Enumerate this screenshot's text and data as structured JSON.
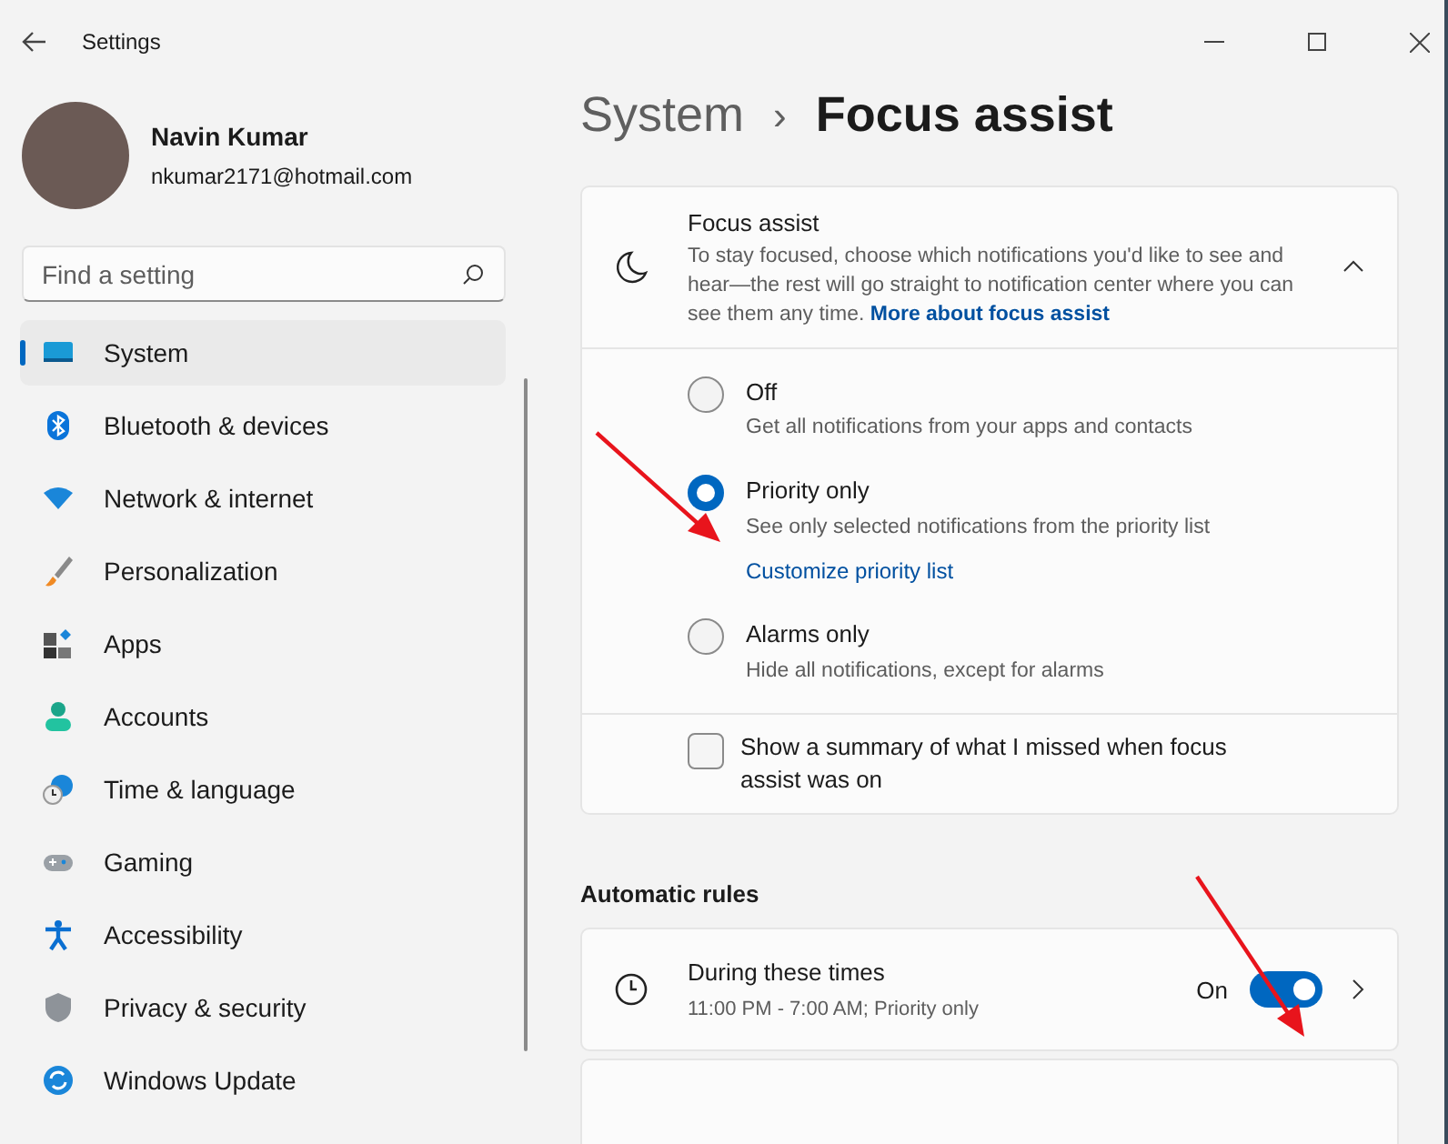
{
  "window": {
    "title": "Settings"
  },
  "account": {
    "name": "Navin Kumar",
    "email": "nkumar2171@hotmail.com"
  },
  "search": {
    "placeholder": "Find a setting"
  },
  "sidebar": {
    "items": [
      {
        "label": "System",
        "selected": true
      },
      {
        "label": "Bluetooth & devices",
        "selected": false
      },
      {
        "label": "Network & internet",
        "selected": false
      },
      {
        "label": "Personalization",
        "selected": false
      },
      {
        "label": "Apps",
        "selected": false
      },
      {
        "label": "Accounts",
        "selected": false
      },
      {
        "label": "Time & language",
        "selected": false
      },
      {
        "label": "Gaming",
        "selected": false
      },
      {
        "label": "Accessibility",
        "selected": false
      },
      {
        "label": "Privacy & security",
        "selected": false
      },
      {
        "label": "Windows Update",
        "selected": false
      }
    ]
  },
  "breadcrumb": {
    "parent": "System",
    "separator": "›",
    "current": "Focus assist"
  },
  "focus_card": {
    "title": "Focus assist",
    "description": "To stay focused, choose which notifications you'd like to see and hear—the rest will go straight to notification center where you can see them any time.",
    "link": "More about focus assist",
    "expanded": true,
    "options": [
      {
        "label": "Off",
        "description": "Get all notifications from your apps and contacts",
        "selected": false
      },
      {
        "label": "Priority only",
        "description": "See only selected notifications from the priority list",
        "link": "Customize priority list",
        "selected": true
      },
      {
        "label": "Alarms only",
        "description": "Hide all notifications, except for alarms",
        "selected": false
      }
    ],
    "summary": {
      "label": "Show a summary of what I missed when focus assist was on",
      "checked": false
    }
  },
  "automatic_rules": {
    "heading": "Automatic rules",
    "rules": [
      {
        "title": "During these times",
        "subtitle": "11:00 PM - 7:00 AM; Priority only",
        "state_label": "On",
        "on": true
      }
    ]
  }
}
